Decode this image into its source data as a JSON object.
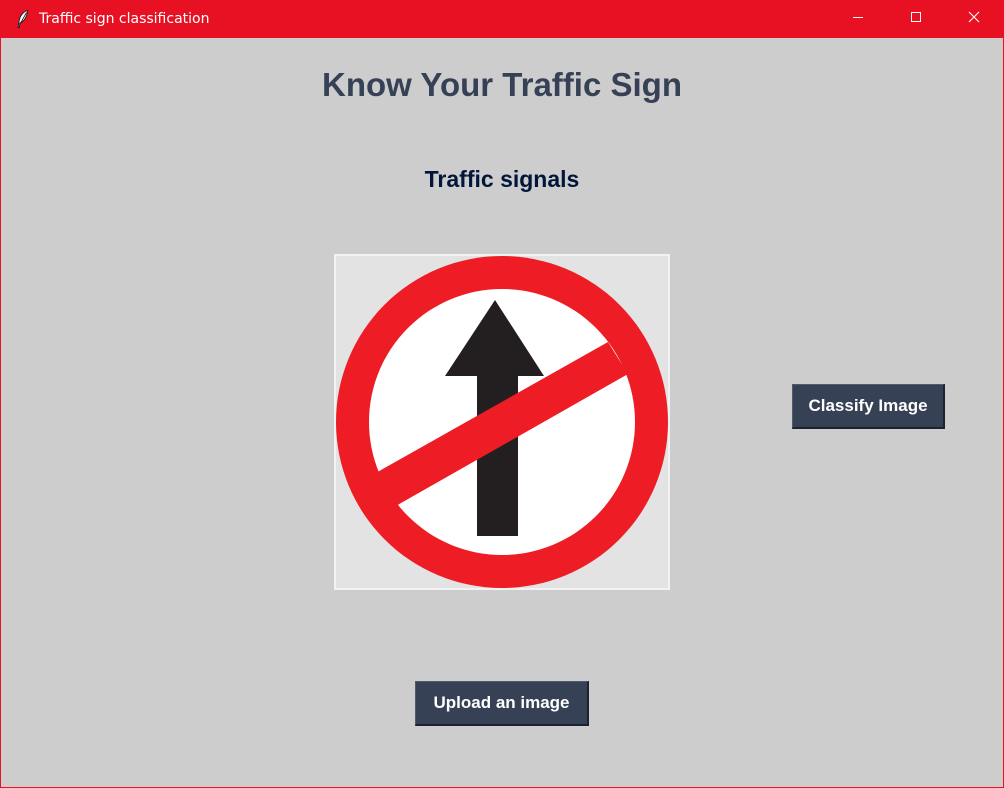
{
  "window": {
    "title": "Traffic sign classification",
    "app_icon": "feather-icon",
    "controls": {
      "minimize_icon": "minimize-icon",
      "maximize_icon": "maximize-icon",
      "close_icon": "close-icon"
    },
    "titlebar_color": "#e81123",
    "background_color": "#cdcdcd"
  },
  "main": {
    "heading": "Know Your Traffic Sign",
    "subheading": "Traffic signals",
    "heading_color": "#364156",
    "subheading_color": "#011638",
    "image": {
      "depicts": "no-straight-ahead-sign",
      "ring_color": "#ee1c24",
      "arrow_color": "#231f20"
    },
    "classify_button": "Classify Image",
    "upload_button": "Upload an image",
    "button_color": "#364156"
  }
}
